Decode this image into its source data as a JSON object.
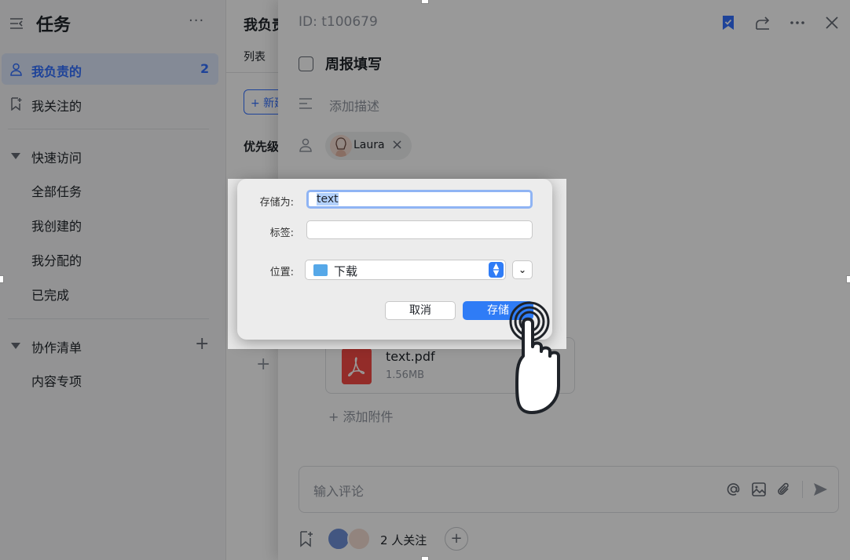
{
  "sidebar": {
    "title": "任务",
    "more": "···",
    "nav": [
      {
        "label": "我负责的",
        "count": "2",
        "active": true
      },
      {
        "label": "我关注的",
        "count": "",
        "active": false
      }
    ],
    "quick_access": {
      "title": "快速访问",
      "items": [
        "全部任务",
        "我创建的",
        "我分配的",
        "已完成"
      ]
    },
    "collab": {
      "title": "协作清单",
      "add": "+",
      "items": [
        "内容专项"
      ]
    }
  },
  "middle": {
    "title": "我负责",
    "tab": "列表",
    "new_button": "+ 新建",
    "priority_group": "优先级",
    "add": "+"
  },
  "detail": {
    "id_text": "ID:  t100679",
    "task_name": "周报填写",
    "desc_placeholder": "添加描述",
    "assignee": "Laura",
    "assignee_remove": "×",
    "attachment": {
      "name": "text.pdf",
      "size": "1.56MB"
    },
    "add_attachment": "+ 添加附件",
    "comment_placeholder": "输入评论",
    "followers_text": "2 人关注",
    "followers_add": "+"
  },
  "save_dialog": {
    "save_as_label": "存储为:",
    "save_as_value": "text",
    "tags_label": "标签:",
    "tags_value": "",
    "location_label": "位置:",
    "location_value": "下载",
    "cancel_label": "取消",
    "save_label": "存储"
  },
  "colors": {
    "accent": "#3370ff",
    "dialog_primary": "#2f7cf6",
    "overlay": "rgba(0,0,0,0.40)"
  }
}
